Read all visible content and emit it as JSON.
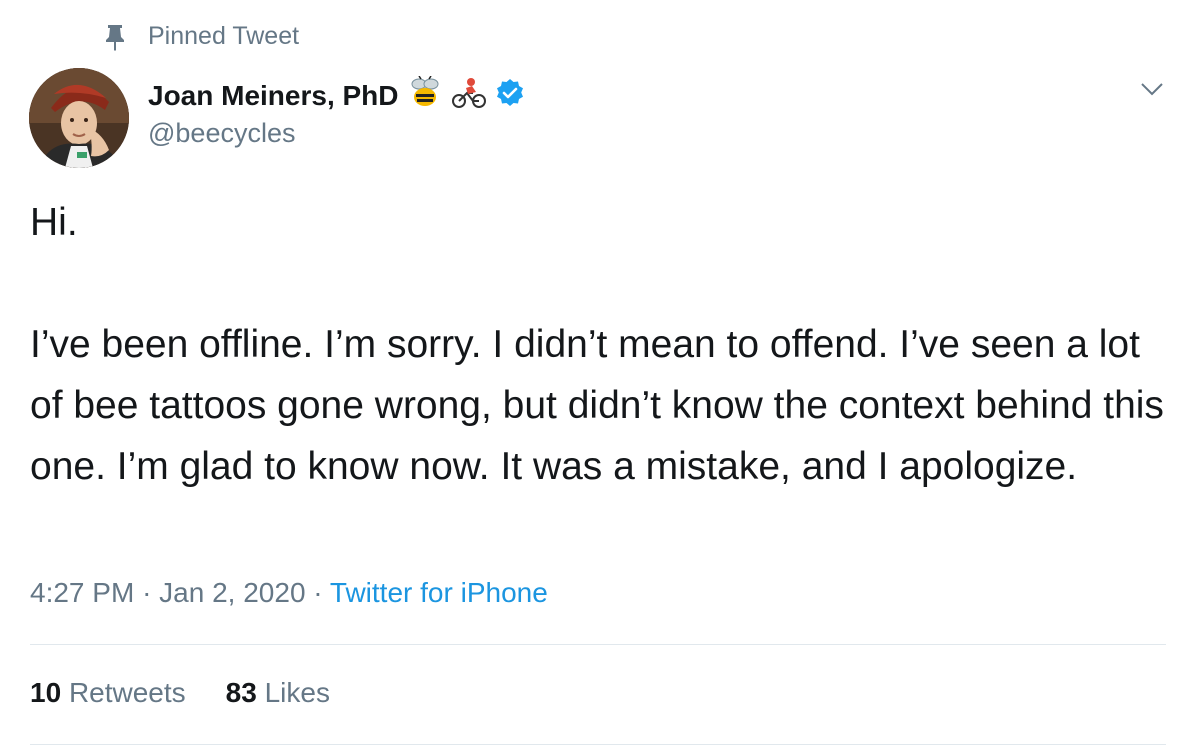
{
  "pinned_label": "Pinned Tweet",
  "user": {
    "display_name": "Joan Meiners, PhD",
    "handle": "@beecycles",
    "emojis": [
      "bee-emoji",
      "cyclist-emoji"
    ],
    "verified": true
  },
  "tweet": {
    "text": "Hi.\n\nI’ve been offline. I’m sorry. I didn’t mean to offend. I’ve seen a lot of bee tattoos gone wrong, but didn’t know the context behind this one. I’m glad to know now. It was a mistake, and I apologize.",
    "time": "4:27 PM",
    "date": "Jan 2, 2020",
    "separator": "·",
    "source": "Twitter for iPhone"
  },
  "stats": {
    "retweets_count": "10",
    "retweets_label": "Retweets",
    "likes_count": "83",
    "likes_label": "Likes"
  },
  "colors": {
    "accent": "#1b95e0",
    "verified": "#1da1f2",
    "muted": "#657786",
    "divider": "#e1e8ed"
  },
  "icons": {
    "pin": "pin-icon",
    "verified": "verified-badge-icon",
    "caret": "chevron-down-icon"
  }
}
